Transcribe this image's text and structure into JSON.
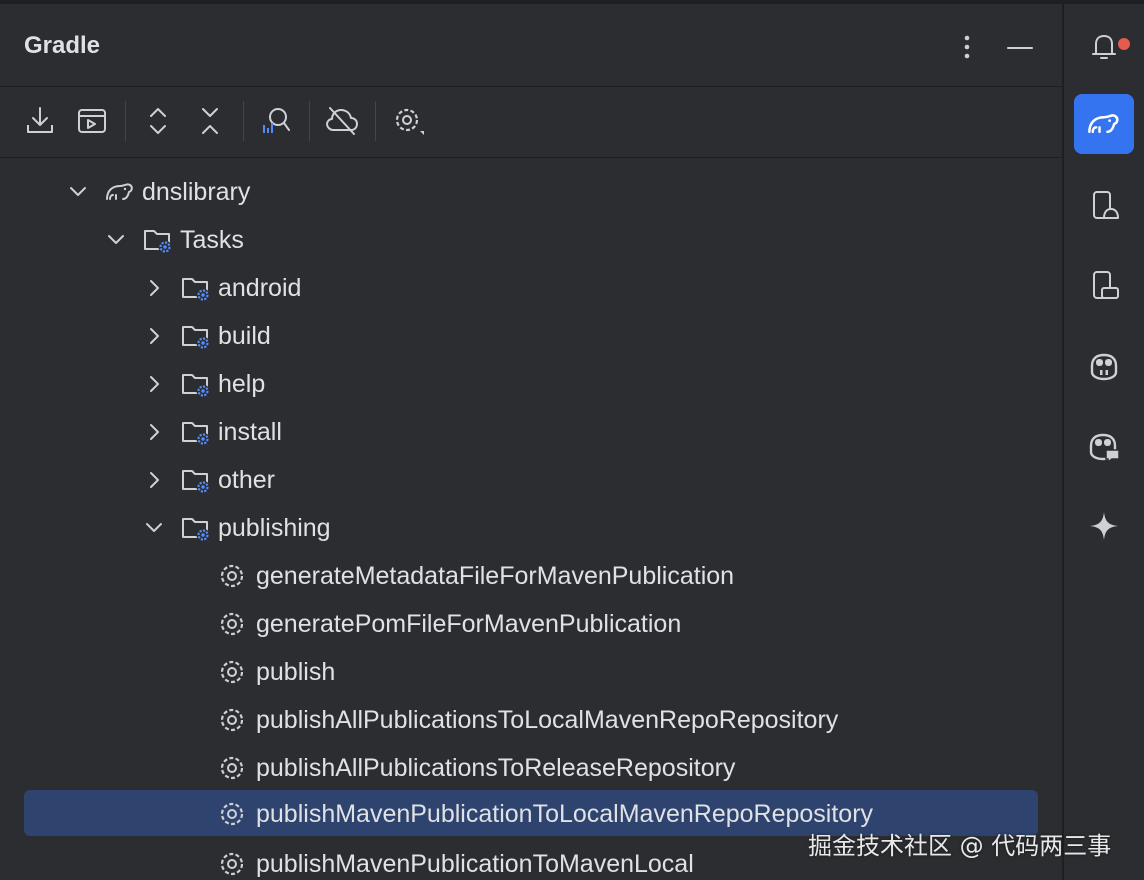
{
  "panel": {
    "title": "Gradle"
  },
  "toolbar": {
    "buttons": [
      "download-sources-icon",
      "run-configuration-icon",
      "expand-all-icon",
      "collapse-all-icon",
      "analyze-dependencies-icon",
      "offline-mode-icon",
      "settings-icon"
    ]
  },
  "tree": {
    "project": {
      "label": "dnslibrary",
      "expanded": true
    },
    "tasks": {
      "label": "Tasks",
      "expanded": true
    },
    "groups": [
      {
        "label": "android",
        "expanded": false
      },
      {
        "label": "build",
        "expanded": false
      },
      {
        "label": "help",
        "expanded": false
      },
      {
        "label": "install",
        "expanded": false
      },
      {
        "label": "other",
        "expanded": false
      },
      {
        "label": "publishing",
        "expanded": true
      }
    ],
    "publishing_tasks": [
      "generateMetadataFileForMavenPublication",
      "generatePomFileForMavenPublication",
      "publish",
      "publishAllPublicationsToLocalMavenRepoRepository",
      "publishAllPublicationsToReleaseRepository",
      "publishMavenPublicationToLocalMavenRepoRepository",
      "publishMavenPublicationToMavenLocal"
    ],
    "selected_task": "publishMavenPublicationToLocalMavenRepoRepository"
  },
  "sidebar": {
    "items": [
      "notifications-icon",
      "gradle-icon",
      "device-manager-icon",
      "running-devices-icon",
      "copilot-icon",
      "copilot-chat-icon",
      "ai-assistant-icon"
    ],
    "active": "gradle-icon",
    "notification_dot": true
  },
  "colors": {
    "background": "#2b2d30",
    "selection": "#2e436e",
    "accent": "#3574f0",
    "badge": "#e55b4f",
    "task_icon_blue": "#548af7"
  },
  "watermark": "掘金技术社区 @ 代码两三事"
}
